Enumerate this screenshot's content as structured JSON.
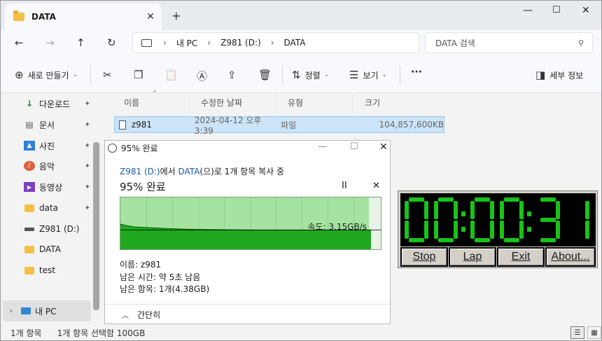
{
  "window": {
    "tab_title": "DATA",
    "tab_close": "✕",
    "new_tab": "+",
    "minimize": "—",
    "maximize": "☐",
    "close": "✕"
  },
  "nav": {
    "back": "←",
    "forward": "→",
    "up": "↑",
    "refresh": "↻"
  },
  "address": {
    "segments": [
      "내 PC",
      "Z981 (D:)",
      "DATA"
    ],
    "chevron": "›"
  },
  "search": {
    "placeholder": "DATA 검색",
    "icon": "search-icon"
  },
  "commands": {
    "new_label": "새로 만들기",
    "sort_label": "정렬",
    "view_label": "보기",
    "details_label": "세부 정보",
    "more": "···"
  },
  "sidebar": {
    "items": [
      {
        "label": "다운로드",
        "icon": "download-icon",
        "pinned": true
      },
      {
        "label": "문서",
        "icon": "document-icon",
        "pinned": true
      },
      {
        "label": "사진",
        "icon": "picture-icon",
        "pinned": true
      },
      {
        "label": "음악",
        "icon": "music-icon",
        "pinned": true
      },
      {
        "label": "동영상",
        "icon": "video-icon",
        "pinned": true
      },
      {
        "label": "data",
        "icon": "folder-icon",
        "pinned": true
      },
      {
        "label": "Z981 (D:)",
        "icon": "drive-icon",
        "pinned": false
      },
      {
        "label": "DATA",
        "icon": "folder-icon",
        "pinned": false
      },
      {
        "label": "test",
        "icon": "folder-icon",
        "pinned": false
      }
    ],
    "this_pc": "내 PC",
    "pin_glyph": "📌"
  },
  "list": {
    "columns": [
      "이름",
      "수정한 날짜",
      "유형",
      "크기"
    ],
    "rows": [
      {
        "name": "z981",
        "date": "2024-04-12 오후 3:39",
        "type": "파일",
        "size": "104,857,600KB"
      }
    ]
  },
  "status": {
    "count": "1개 항목",
    "selected": "1개 항목 선택함 100GB"
  },
  "copy_dialog": {
    "title": "95% 완료",
    "from": "Z981 (D:)",
    "from_suffix": "에서 ",
    "to": "DATA",
    "to_suffix": "(으)로 1개 항목 복사 중",
    "percent_label": "95% 완료",
    "progress": 0.95,
    "speed": "속도: 3.15GB/s",
    "name_line": "이름: z981",
    "time_line": "남은 시간: 약 5초 남음",
    "items_line": "남은 항목: 1개(4.38GB)",
    "collapse": "간단히",
    "pause": "II",
    "cancel": "✕"
  },
  "stopwatch": {
    "digits": [
      "0",
      "0",
      "0",
      "0",
      "3",
      "1"
    ],
    "buttons": [
      "Stop",
      "Lap",
      "Exit",
      "About..."
    ],
    "lcd_color": "#19c219"
  }
}
